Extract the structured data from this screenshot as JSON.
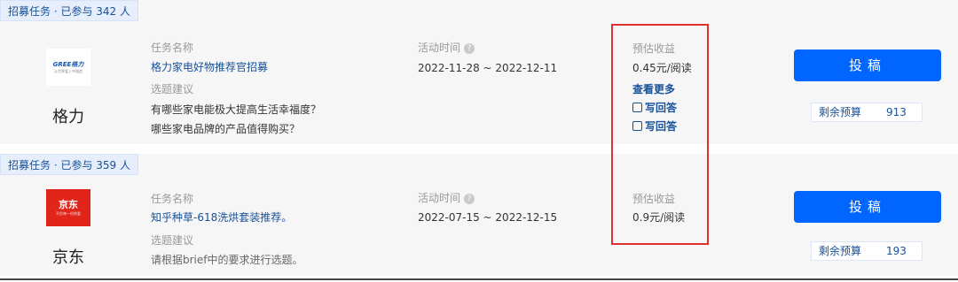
{
  "tasks": [
    {
      "tag": "招募任务 · 已参与 342 人",
      "brand": "格力",
      "logo_text": "GREE格力",
      "logo_sub": "让世界爱上中国造",
      "name_label": "任务名称",
      "name": "格力家电好物推荐官招募",
      "topic_label": "选题建议",
      "topics": [
        "有哪些家电能极大提高生活幸福度？",
        "哪些家电品牌的产品值得购买？"
      ],
      "time_label": "活动时间",
      "time": "2022-11-28 ~ 2022-12-11",
      "earn_label": "预估收益",
      "earn": "0.45元/阅读",
      "more": "查看更多",
      "actions": [
        "写回答",
        "写回答"
      ],
      "button": "投稿",
      "budget_label": "剩余预算",
      "budget_value": "913"
    },
    {
      "tag": "招募任务 · 已参与 359 人",
      "brand": "京东",
      "logo_text": "京东",
      "logo_sub": "不负每一份热爱",
      "name_label": "任务名称",
      "name": "知乎种草-618洗烘套装推荐。",
      "topic_label": "选题建议",
      "topics": [
        "请根据brief中的要求进行选题。"
      ],
      "time_label": "活动时间",
      "time": "2022-07-15 ~ 2022-12-15",
      "earn_label": "预估收益",
      "earn": "0.9元/阅读",
      "button": "投稿",
      "budget_label": "剩余预算",
      "budget_value": "193"
    }
  ],
  "colors": {
    "link": "#175199",
    "button": "#0066ff",
    "highlight": "#e03131"
  }
}
